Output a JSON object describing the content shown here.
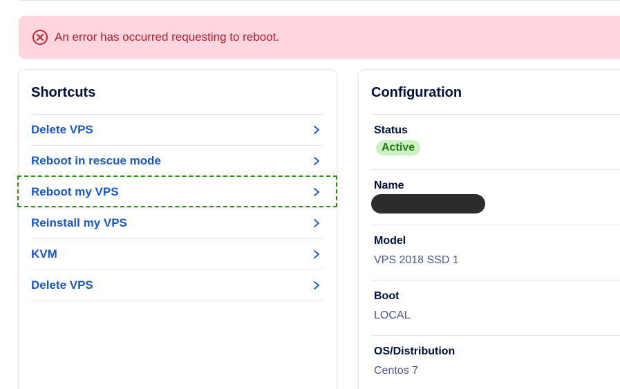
{
  "alert": {
    "message": "An error has occurred requesting to reboot.",
    "icon": "error-circle-x-icon",
    "color": "#b41e2a",
    "background": "#ffd6de"
  },
  "shortcuts": {
    "title": "Shortcuts",
    "items": [
      {
        "label": "Delete VPS"
      },
      {
        "label": "Reboot in rescue mode"
      },
      {
        "label": "Reboot my VPS",
        "focused": true
      },
      {
        "label": "Reinstall my VPS"
      },
      {
        "label": "KVM"
      },
      {
        "label": "Delete VPS"
      }
    ]
  },
  "configuration": {
    "title": "Configuration",
    "rows": [
      {
        "key": "Status",
        "value": "Active",
        "type": "badge"
      },
      {
        "key": "Name",
        "value": "",
        "type": "redacted"
      },
      {
        "key": "Model",
        "value": "VPS 2018 SSD 1",
        "type": "text"
      },
      {
        "key": "Boot",
        "value": "LOCAL",
        "type": "text"
      },
      {
        "key": "OS/Distribution",
        "value": "Centos 7",
        "type": "text"
      }
    ]
  },
  "colors": {
    "link": "#1a56c6",
    "heading": "#000e3c",
    "value": "#4d5693",
    "badge_bg": "#cdf0c2",
    "badge_text": "#1f7a13",
    "focus_outline": "#2f8a16"
  }
}
